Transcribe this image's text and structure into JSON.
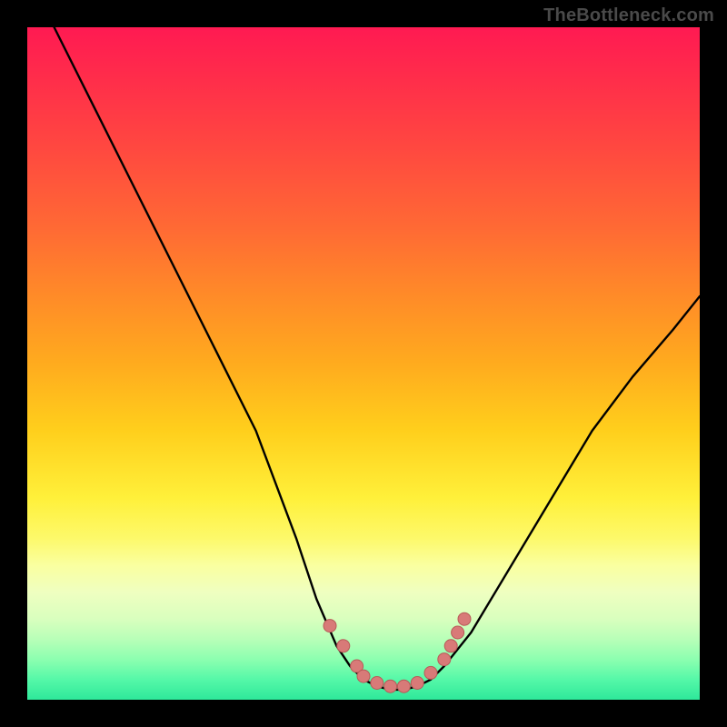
{
  "watermark": "TheBottleneck.com",
  "colors": {
    "frame": "#000000",
    "curve_stroke": "#000000",
    "marker_fill": "#d87a78",
    "marker_stroke": "#b85a58"
  },
  "chart_data": {
    "type": "line",
    "title": "",
    "xlabel": "",
    "ylabel": "",
    "xlim": [
      0,
      100
    ],
    "ylim": [
      0,
      100
    ],
    "grid": false,
    "legend": false,
    "series": [
      {
        "name": "left-branch",
        "x": [
          4,
          10,
          16,
          22,
          28,
          34,
          40,
          43,
          46,
          48
        ],
        "values": [
          100,
          88,
          76,
          64,
          52,
          40,
          24,
          15,
          8,
          5
        ]
      },
      {
        "name": "floor",
        "x": [
          48,
          50,
          52,
          54,
          56,
          58,
          60,
          62
        ],
        "values": [
          5,
          3,
          2,
          1.5,
          1.5,
          2,
          3,
          5
        ]
      },
      {
        "name": "right-branch",
        "x": [
          62,
          66,
          72,
          78,
          84,
          90,
          96,
          100
        ],
        "values": [
          5,
          10,
          20,
          30,
          40,
          48,
          55,
          60
        ]
      }
    ],
    "markers": [
      {
        "x": 45,
        "y": 11
      },
      {
        "x": 47,
        "y": 8
      },
      {
        "x": 49,
        "y": 5
      },
      {
        "x": 50,
        "y": 3.5
      },
      {
        "x": 52,
        "y": 2.5
      },
      {
        "x": 54,
        "y": 2
      },
      {
        "x": 56,
        "y": 2
      },
      {
        "x": 58,
        "y": 2.5
      },
      {
        "x": 60,
        "y": 4
      },
      {
        "x": 62,
        "y": 6
      },
      {
        "x": 63,
        "y": 8
      },
      {
        "x": 64,
        "y": 10
      },
      {
        "x": 65,
        "y": 12
      }
    ]
  }
}
